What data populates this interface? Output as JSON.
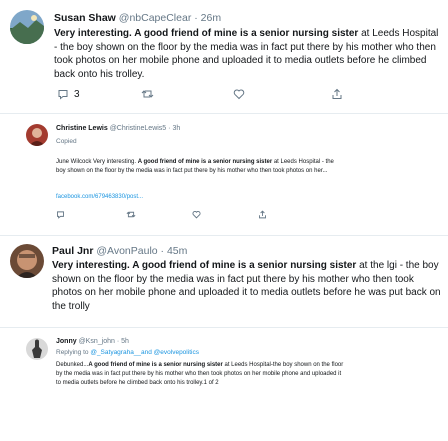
{
  "tweet1": {
    "name": "Susan Shaw",
    "handle": "@nbCapeClear",
    "time": "26m",
    "text_bold": "Very interesting. A good friend of mine is a senior nursing sister",
    "text_rest": " at Leeds Hospital - the boy shown on the floor by the media was in fact put there by his mother who then took photos on her mobile phone and uploaded it to media outlets before he climbed back onto his trolley.",
    "reply_count": "3"
  },
  "tweet2": {
    "name": "Christine Lewis",
    "handle": "@ChristineLewis5",
    "time": "3h",
    "status": "Copied",
    "text_pre": "June Wilcock Very interesting. ",
    "text_bold": "A good friend of mine is a senior nursing sister",
    "text_rest": " at Leeds Hospital - the boy shown on the floor by the media was in fact put there by his mother who then took photos on her...",
    "link": "facebook.com/679463830/post..."
  },
  "tweet3": {
    "name": "Paul Jnr",
    "handle": "@AvonPaulo",
    "time": "45m",
    "text_bold": "Very interesting. A good friend of mine is a senior nursing sister",
    "text_rest": " at the lgi - the boy shown on the floor by the media was in fact put there by his mother who then took photos on her mobile phone and uploaded it to media outlets before he was put back on the trolly"
  },
  "tweet4": {
    "name": "Jonny",
    "handle": "@Ksn_john",
    "time": "5h",
    "replying_label": "Replying to",
    "replying_handles": "@_Satyagraha__and @evolvepolitics",
    "text_pre": "Debunked...",
    "text_bold": "A good friend of mine is a senior nursing sister",
    "text_rest": " at Leeds Hospital-the boy shown on the floor by the media was in fact put there by his mother who then took photos on her mobile phone and uploaded it to media outlets before he climbed back onto his trolley.1 of 2"
  },
  "icons": [
    "reply-icon",
    "retweet-icon",
    "like-icon",
    "share-icon"
  ],
  "colors": {
    "link": "#1b95e0",
    "meta": "#657786",
    "divider": "#e6ecf0",
    "text": "#14171a"
  }
}
